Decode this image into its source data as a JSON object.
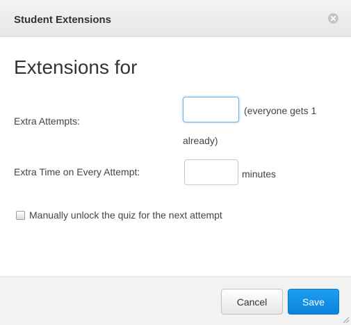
{
  "dialog": {
    "title": "Student Extensions",
    "heading": "Extensions for"
  },
  "form": {
    "extra_attempts_label": "Extra Attempts:",
    "extra_attempts_value": "",
    "extra_attempts_note_line1": "(everyone gets 1",
    "extra_attempts_note_line2": "already)",
    "extra_time_label": "Extra Time on Every Attempt:",
    "extra_time_value": "",
    "extra_time_unit": "minutes",
    "unlock_label": "Manually unlock the quiz for the next attempt",
    "unlock_checked": false
  },
  "footer": {
    "cancel_label": "Cancel",
    "save_label": "Save"
  },
  "colors": {
    "accent": "#0b83d9",
    "focus_ring": "#66afe9"
  },
  "icons": {
    "close": "close-icon",
    "resize": "resize-grip-icon"
  }
}
